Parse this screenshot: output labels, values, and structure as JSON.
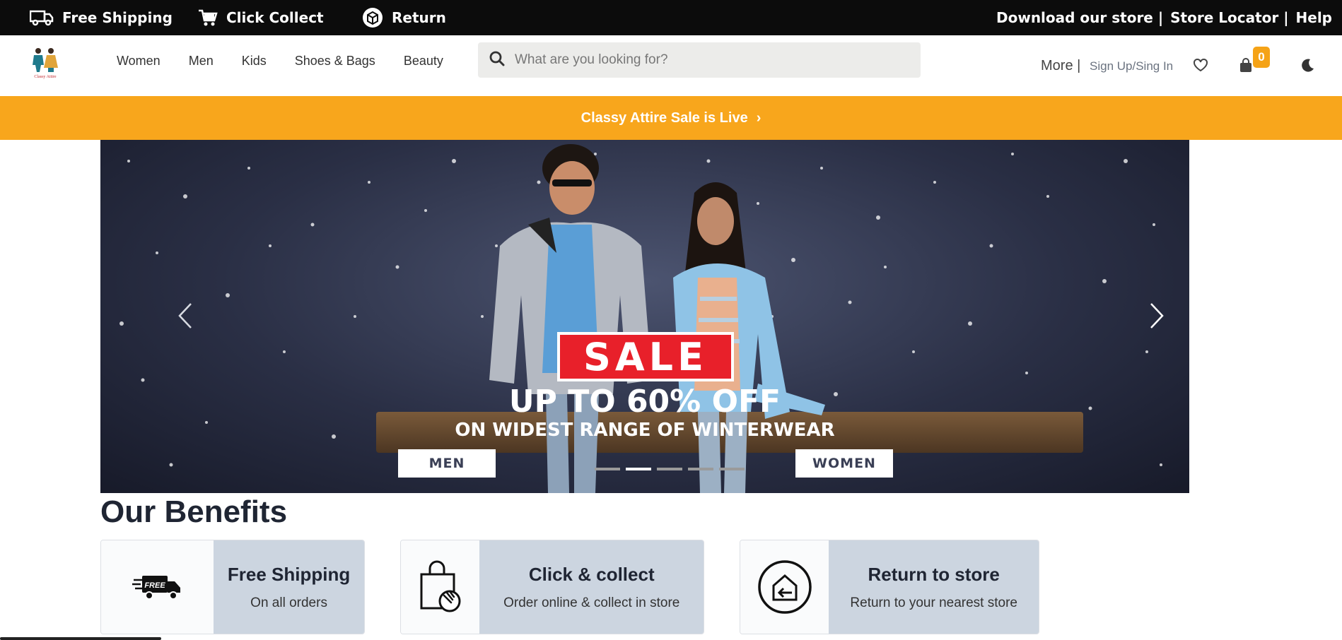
{
  "topbar": {
    "items": [
      {
        "label": "Free Shipping",
        "icon": "truck-icon"
      },
      {
        "label": "Click Collect",
        "icon": "cart-icon"
      },
      {
        "label": "Return",
        "icon": "box-icon"
      }
    ],
    "right_links": [
      "Download our store |",
      "Store Locator |",
      "Help"
    ]
  },
  "header": {
    "logo_text": "Classy Attire",
    "nav": [
      "Women",
      "Men",
      "Kids",
      "Shoes & Bags",
      "Beauty"
    ],
    "search_placeholder": "What are you looking for?",
    "more_label": "More |",
    "signin_label": "Sign Up/Sing In",
    "cart_count": "0"
  },
  "promo": {
    "text": "Classy Attire Sale is Live",
    "arrow": "›",
    "color": "#f8a61c"
  },
  "hero": {
    "sale_label": "SALE",
    "line1": "UP TO 60% OFF",
    "line2": "ON WIDEST RANGE OF WINTERWEAR",
    "cta_men": "MEN",
    "cta_women": "WOMEN",
    "slides_total": 5,
    "active_slide": 2
  },
  "benefits": {
    "title": "Our Benefits",
    "cards": [
      {
        "title": "Free Shipping",
        "subtitle": "On all orders",
        "icon": "free-truck-icon",
        "icon_text": "FREE"
      },
      {
        "title": "Click & collect",
        "subtitle": "Order online & collect in store",
        "icon": "shopping-bag-hand-icon"
      },
      {
        "title": "Return to store",
        "subtitle": "Return to your nearest store",
        "icon": "return-home-icon"
      }
    ]
  }
}
